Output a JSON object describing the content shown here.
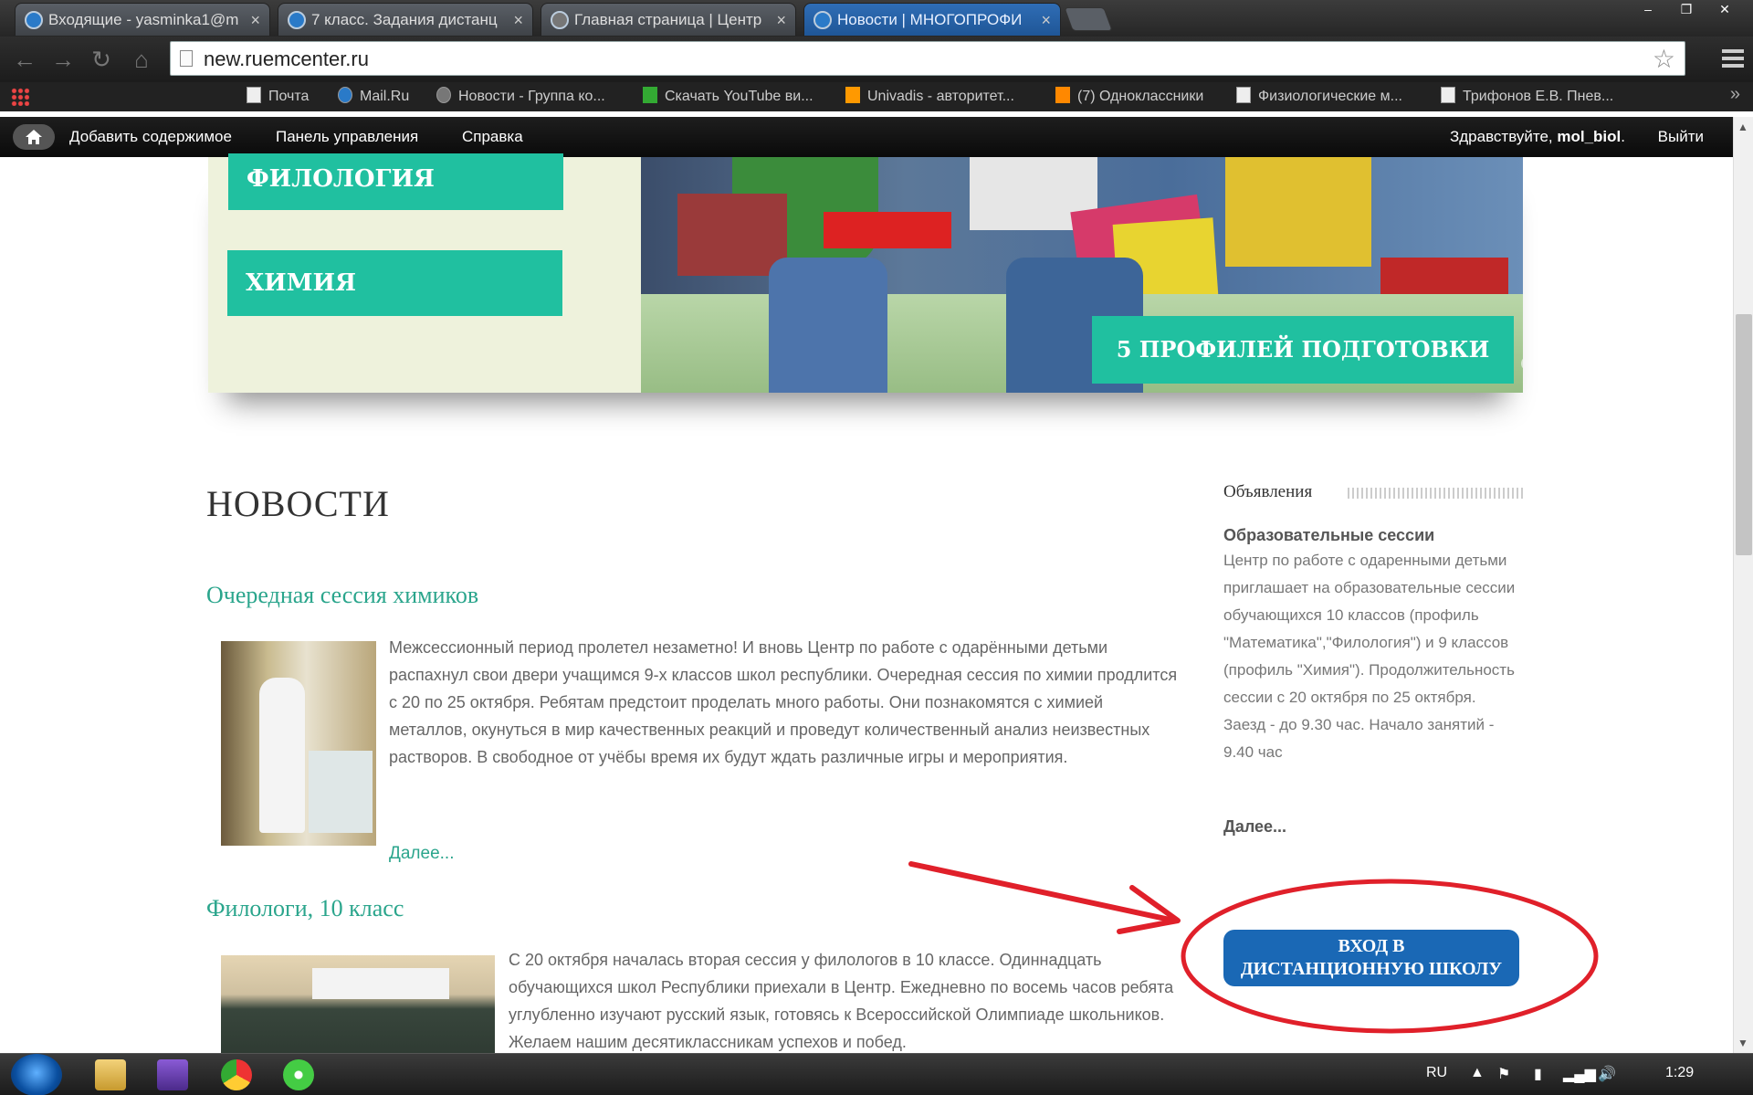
{
  "browser": {
    "tabs": [
      {
        "title": "Входящие - yasminka1@m",
        "active": false
      },
      {
        "title": "7 класс. Задания дистанц",
        "active": false
      },
      {
        "title": "Главная страница | Центр",
        "active": false
      },
      {
        "title": "Новости | МНОГОПРОФИ",
        "active": true
      }
    ],
    "url": "new.ruemcenter.ru",
    "bookmarks": [
      "Почта",
      "Mail.Ru",
      "Новости - Группа ко...",
      "Скачать YouTube ви...",
      "Univadis - авторитет...",
      "(7) Одноклассники",
      "Физиологические м...",
      "Трифонов Е.В. Пнев..."
    ],
    "bookmarks_more": "»"
  },
  "admin_bar": {
    "add_content": "Добавить содержимое",
    "dashboard": "Панель управления",
    "help": "Справка",
    "greeting": "Здравствуйте,",
    "username": "mol_biol",
    "greeting_end": ".",
    "logout": "Выйти"
  },
  "slider": {
    "subjects": [
      "ФИЛОЛОГИЯ",
      "ХИМИЯ"
    ],
    "profiles_button": "5 ПРОФИЛЕЙ ПОДГОТОВКИ",
    "dot_count": 5,
    "active_dot": 2
  },
  "main": {
    "heading": "НОВОСТИ",
    "articles": [
      {
        "title": "Очередная сессия химиков",
        "text": "Межсессионный период пролетел незаметно! И вновь Центр по работе с одарёнными детьми распахнул свои двери учащимся 9-х классов школ республики. Очередная сессия по химии продлится с 20 по 25 октября. Ребятам предстоит проделать много работы. Они познакомятся с химией металлов, окунуться в мир качественных реакций и проведут количественный анализ неизвестных растворов. В свободное от учёбы время их будут ждать различные игры и мероприятия.",
        "more": "Далее..."
      },
      {
        "title": "Филологи, 10 класс",
        "text": "С 20 октября началась вторая сессия у филологов в 10 классе. Одиннадцать обучающихся школ Республики приехали в Центр. Ежедневно по восемь часов ребята углубленно изучают русский язык, готовясь к Всероссийской Олимпиаде школьников. Желаем нашим десятиклассникам успехов и побед."
      }
    ]
  },
  "sidebar": {
    "title": "Объявления",
    "announcement_title": "Образовательные сессии",
    "announcement_text": "Центр по работе с одаренными детьми приглашает на образовательные сессии обучающихся 10 классов (профиль \"Математика\",\"Филология\") и 9 классов (профиль \"Химия\"). Продолжительность сессии с 20 октября по 25 октября. Заезд - до 9.30 час. Начало занятий - 9.40 час",
    "more": "Далее...",
    "distance_button_line1": "ВХОД В",
    "distance_button_line2": "ДИСТАНЦИОННУЮ ШКОЛУ"
  },
  "taskbar": {
    "language": "RU",
    "time": "1:29"
  },
  "colors": {
    "accent": "#20c0a0",
    "link": "#2aa58c",
    "button_blue": "#1a68b5",
    "annotation_red": "#e0202a"
  }
}
